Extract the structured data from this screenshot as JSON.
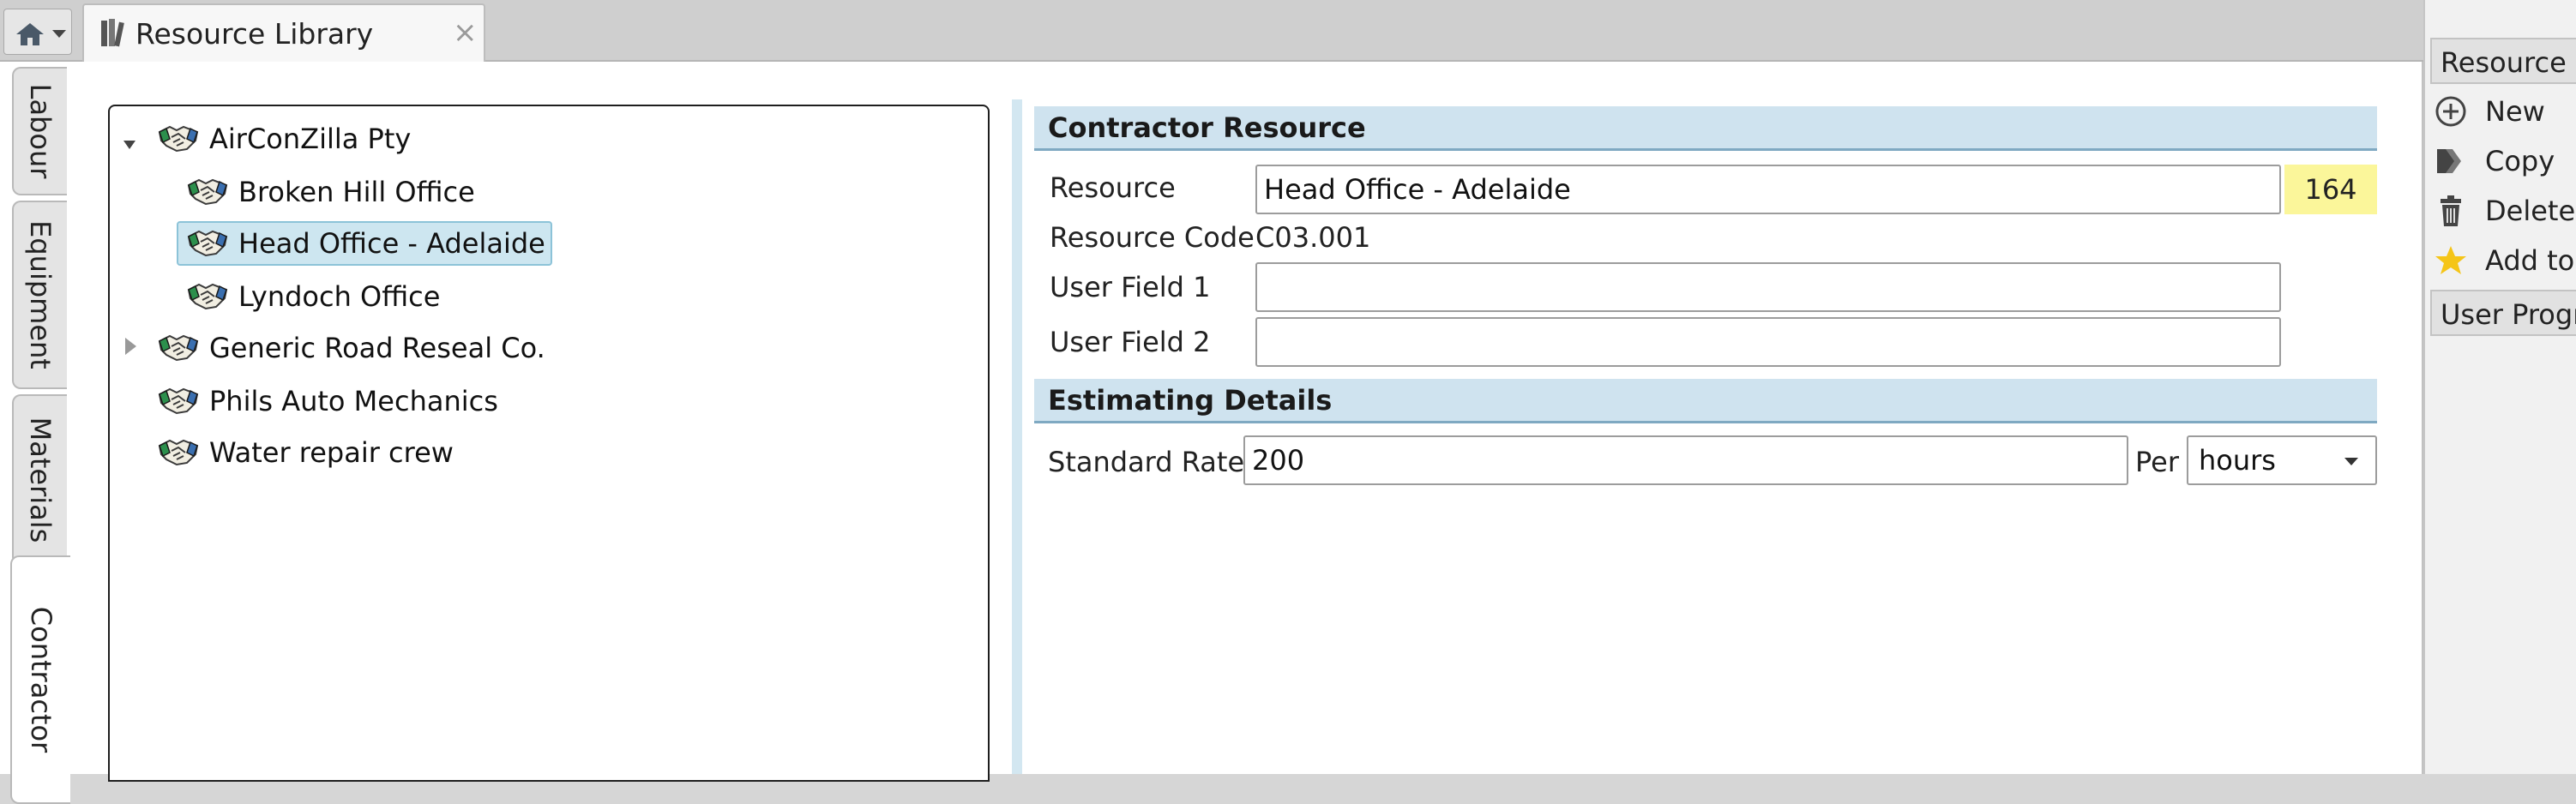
{
  "toolbar": {
    "home_icon": "home-icon",
    "tab_title": "Resource Library",
    "tab_close": "×"
  },
  "left_tabs": [
    {
      "label": "Labour",
      "active": false
    },
    {
      "label": "Equipment",
      "active": false
    },
    {
      "label": "Materials",
      "active": false
    },
    {
      "label": "Contractor",
      "active": true
    }
  ],
  "tree": {
    "nodes": [
      {
        "label": "AirConZilla Pty",
        "level": 0,
        "expander": "expanded"
      },
      {
        "label": "Broken Hill Office",
        "level": 1,
        "expander": "none"
      },
      {
        "label": "Head Office - Adelaide",
        "level": 1,
        "expander": "none",
        "selected": true
      },
      {
        "label": "Lyndoch Office",
        "level": 1,
        "expander": "none"
      },
      {
        "label": "Generic Road Reseal Co.",
        "level": 0,
        "expander": "collapsed"
      },
      {
        "label": "Phils Auto Mechanics",
        "level": 0,
        "expander": "none"
      },
      {
        "label": "Water repair crew",
        "level": 0,
        "expander": "none"
      }
    ],
    "node_icon": "handshake-icon"
  },
  "contractor": {
    "section_title": "Contractor Resource",
    "resource_label": "Resource",
    "resource_value": "Head Office - Adelaide",
    "resource_id": "164",
    "code_label": "Resource Code",
    "code_value": "C03.001",
    "user1_label": "User Field 1",
    "user1_value": "",
    "user2_label": "User Field 2",
    "user2_value": ""
  },
  "estimating": {
    "section_title": "Estimating Details",
    "rate_label": "Standard Rate",
    "rate_value": "200",
    "per_label": "Per",
    "per_value": "hours"
  },
  "side_panel": {
    "header": "Resource L",
    "actions": [
      {
        "label": "New",
        "icon": "add-circle-icon"
      },
      {
        "label": "Copy",
        "icon": "copy-icon"
      },
      {
        "label": "Delete",
        "icon": "trash-icon"
      },
      {
        "label": "Add to",
        "icon": "star-icon"
      }
    ],
    "footer": "User Progr"
  },
  "colors": {
    "selection": "#cde6f0",
    "section_header": "#cfe3ef",
    "id_badge": "#fbf69a",
    "star": "#f5c518"
  }
}
